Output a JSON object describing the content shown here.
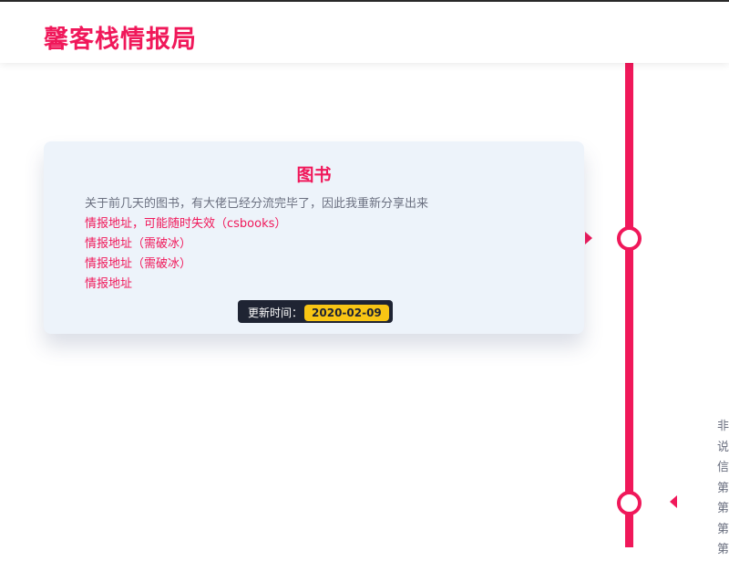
{
  "site": {
    "title": "馨客栈情报局"
  },
  "entries": [
    {
      "title": "图书",
      "description": "关于前几天的图书，有大佬已经分流完毕了，因此我重新分享出来",
      "links": [
        "情报地址，可能随时失效（csbooks）",
        "情报地址（需破冰）",
        "情报地址（需破冰）",
        "情报地址"
      ],
      "update_label": "更新时间：",
      "update_date": "2020-02-09"
    }
  ],
  "side_text_lines": [
    "非",
    "说",
    "信",
    "第",
    "第",
    "第",
    "第"
  ],
  "colors": {
    "accent": "#f0185a",
    "card_bg": "#edf3fa",
    "badge_bg": "#1f2433",
    "date_bg": "#f8c514"
  }
}
